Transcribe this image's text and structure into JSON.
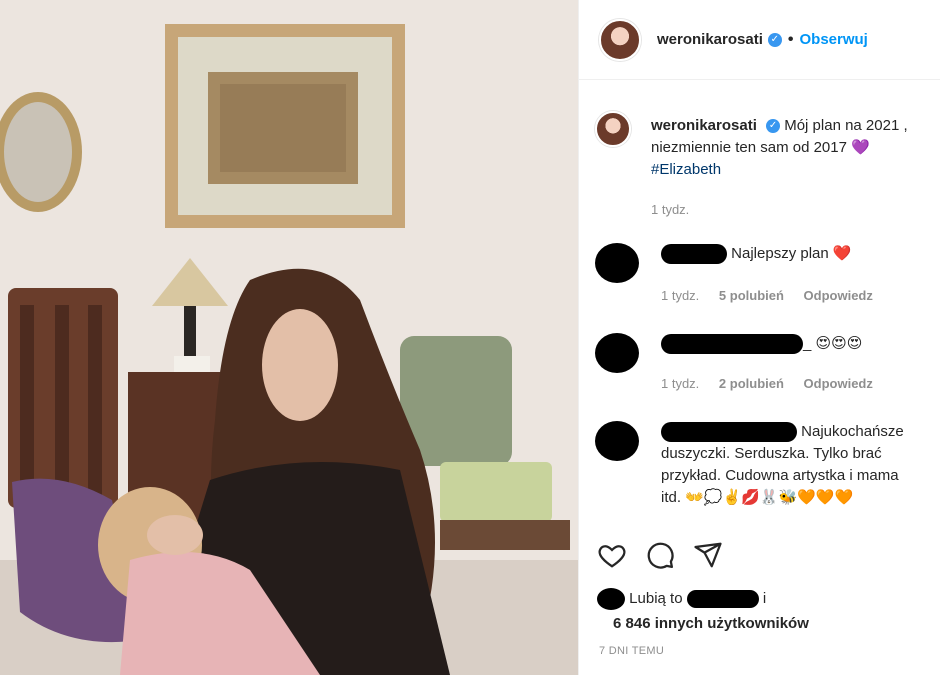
{
  "post": {
    "author": "weronikarosati",
    "follow_label": "Obserwuj",
    "caption_text": "Mój plan na 2021 , niezmiennie ten sam od 2017",
    "caption_emoji": "💜",
    "hashtag": "#Elizabeth",
    "caption_time": "1 tydz.",
    "date": "7 DNI TEMU"
  },
  "comments": [
    {
      "text": "Najlepszy plan",
      "emoji": "❤️",
      "time": "1 tydz.",
      "likes": "5 polubień",
      "reply": "Odpowiedz"
    },
    {
      "text": "_",
      "emoji": "😍😍😍",
      "time": "1 tydz.",
      "likes": "2 polubień",
      "reply": "Odpowiedz"
    },
    {
      "text": "Najukochańsze duszyczki. Serduszka. Tylko brać przykład. Cudowna artystka i mama itd.",
      "emoji": "👐💭✌️💋🐰🐝🧡🧡🧡"
    }
  ],
  "likes": {
    "prefix": "Lubią to",
    "suffix": "i",
    "count_line": "6 846 innych użytkowników"
  },
  "icons": [
    "heart-outline-icon",
    "comment-icon",
    "share-icon",
    "verified-badge-icon"
  ]
}
